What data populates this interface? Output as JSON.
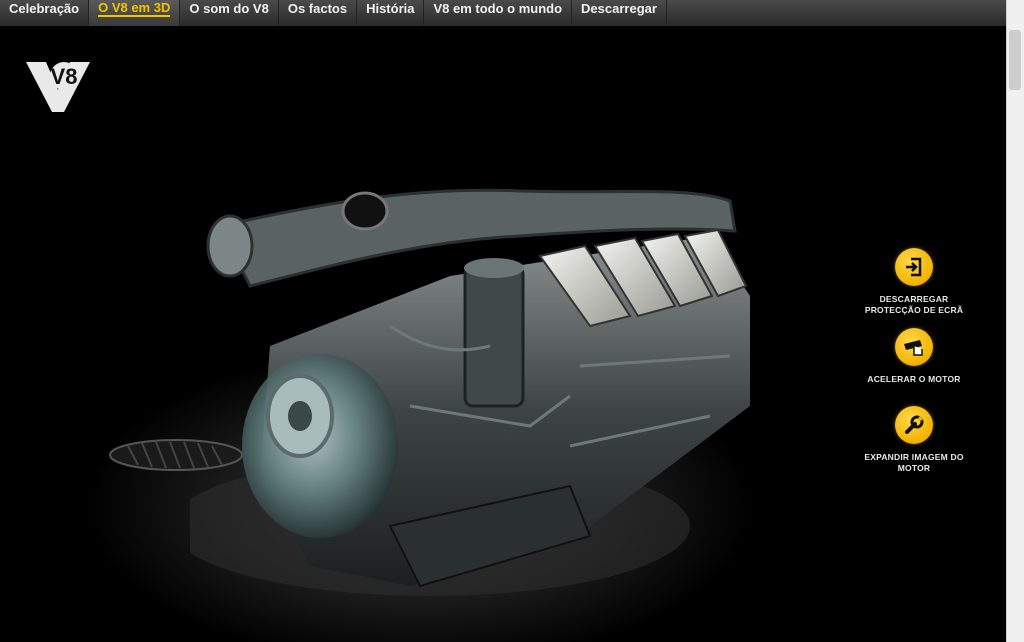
{
  "nav": {
    "tabs": [
      {
        "label": "Celebração",
        "active": false
      },
      {
        "label": "O V8 em 3D",
        "active": true
      },
      {
        "label": "O som do V8",
        "active": false
      },
      {
        "label": "Os factos",
        "active": false
      },
      {
        "label": "História",
        "active": false
      },
      {
        "label": "V8 em todo o mundo",
        "active": false
      },
      {
        "label": "Descarregar",
        "active": false
      }
    ]
  },
  "logo": {
    "text": "V8"
  },
  "actions": {
    "download_screensaver": {
      "line1": "DESCARREGAR",
      "line2": "PROTECÇÃO DE ECRÃ",
      "icon": "download-icon"
    },
    "accelerate": {
      "line1": "ACELERAR O MOTOR",
      "icon": "accelerate-icon"
    },
    "expand": {
      "line1": "EXPANDIR IMAGEM DO",
      "line2": "MOTOR",
      "icon": "wrench-icon"
    }
  },
  "colors": {
    "accent": "#f5c400",
    "nav_bg": "#3a3a3a",
    "button": "#f2b200"
  }
}
